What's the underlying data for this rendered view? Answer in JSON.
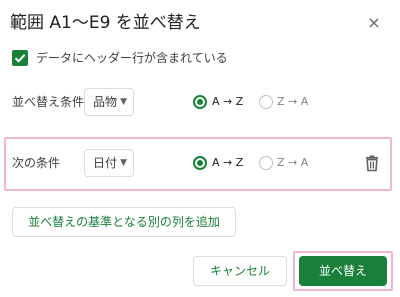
{
  "dialog": {
    "title": "範囲 A1〜E9 を並べ替え",
    "close_symbol": "×"
  },
  "header_checkbox": {
    "checked": true,
    "label": "データにヘッダー行が含まれている"
  },
  "sort_rows": [
    {
      "label": "並べ替え条件",
      "column": "品物",
      "options": [
        "A → Z",
        "Z → A"
      ],
      "selected": "A → Z"
    },
    {
      "label": "次の条件",
      "column": "日付",
      "options": [
        "A → Z",
        "Z → A"
      ],
      "selected": "A → Z"
    }
  ],
  "add_button": "並べ替えの基準となる別の列を追加",
  "footer": {
    "cancel": "キャンセル",
    "sort": "並べ替え"
  },
  "colors": {
    "accent": "#188038",
    "highlight_border": "#f4b6cf"
  },
  "icons": {
    "close": "close-icon",
    "checkbox": "check-icon",
    "dropdown": "dropdown-caret-icon",
    "delete": "trash-icon"
  }
}
